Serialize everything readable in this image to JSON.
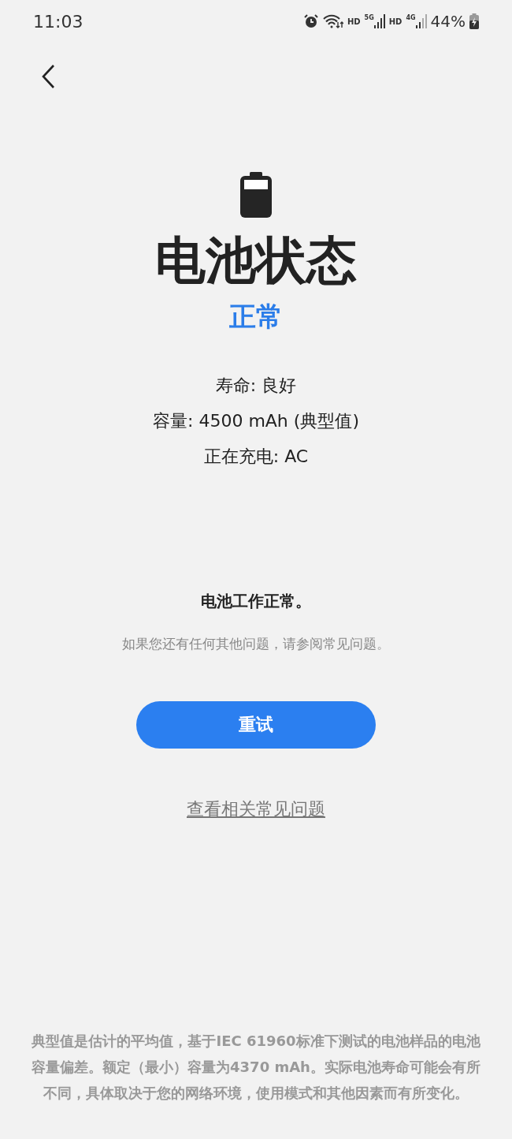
{
  "status_bar": {
    "time": "11:03",
    "wifi_label": "HD",
    "signal_5g": "5G",
    "hd_label": "HD",
    "signal_4g": "4G",
    "battery_percent": "44%"
  },
  "title": "电池状态",
  "status": "正常",
  "details": [
    "寿命: 良好",
    "容量: 4500 mAh (典型值)",
    "正在充电: AC"
  ],
  "message": "电池工作正常。",
  "hint": "如果您还有任何其他问题，请参阅常见问题。",
  "retry_button": "重试",
  "faq_link": "查看相关常见问题",
  "footnote": "典型值是估计的平均值，基于IEC 61960标准下测试的电池样品的电池容量偏差。额定（最小）容量为4370 mAh。实际电池寿命可能会有所不同，具体取决于您的网络环境，使用模式和其他因素而有所变化。"
}
